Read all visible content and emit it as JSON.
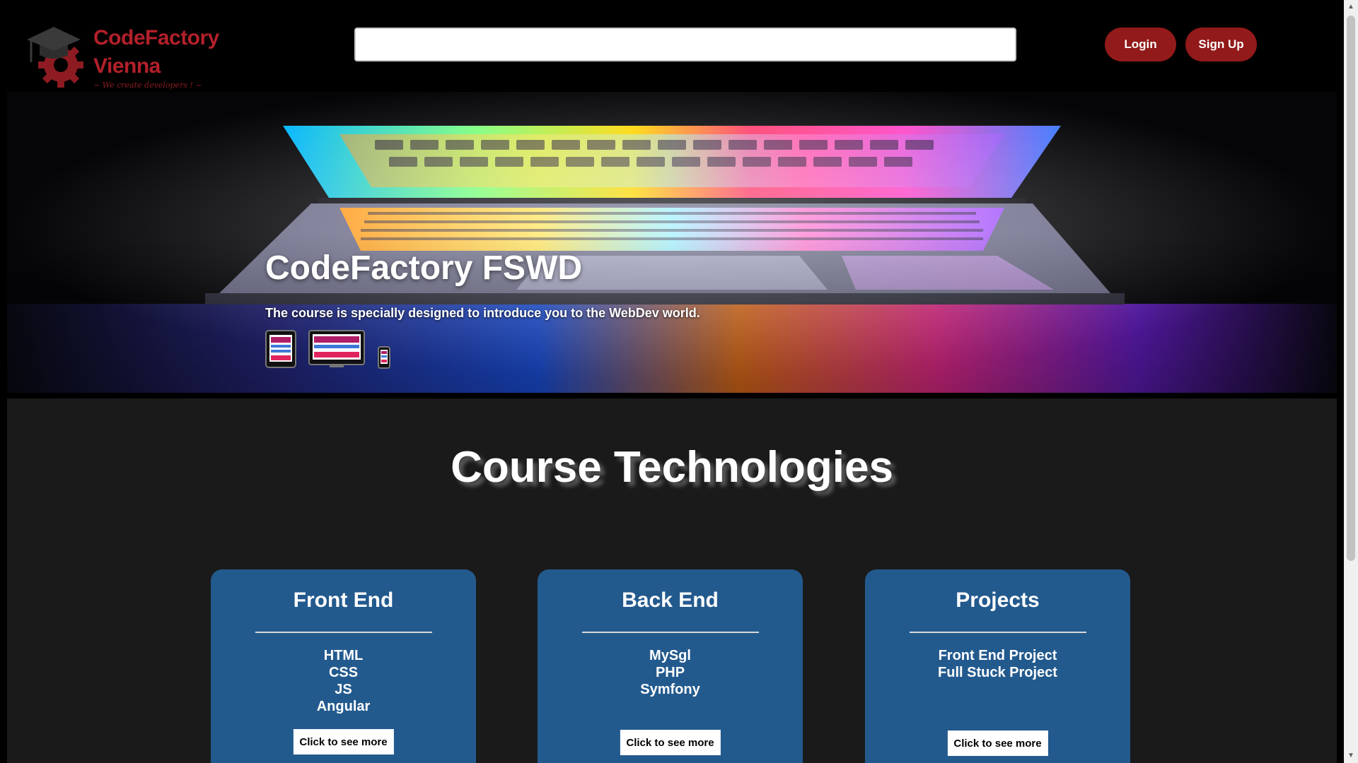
{
  "header": {
    "logo": {
      "line1": "CodeFactory",
      "line2": "Vienna",
      "tagline": "~ We create developers ! ~"
    },
    "search": {
      "value": "",
      "placeholder": ""
    },
    "login_label": "Login",
    "signup_label": "Sign Up"
  },
  "hero": {
    "title": "CodeFactory FSWD",
    "subtitle": "The course is specially designed to introduce you to the WebDev world.",
    "device_icons": [
      "tablet-icon",
      "desktop-icon",
      "phone-icon"
    ]
  },
  "technologies": {
    "title": "Course Technologies",
    "cards": [
      {
        "title": "Front End",
        "items": [
          "HTML",
          "CSS",
          "JS",
          "Angular"
        ],
        "button": "Click to see more"
      },
      {
        "title": "Back End",
        "items": [
          "MySgl",
          "PHP",
          "Symfony"
        ],
        "button": "Click to see more"
      },
      {
        "title": "Projects",
        "items": [
          "Front End Project",
          "Full Stuck Project"
        ],
        "button": "Click to see more"
      }
    ]
  },
  "colors": {
    "brand_red": "#931a1a",
    "card_blue": "#235a8e",
    "section_bg": "#1a1a1a"
  }
}
